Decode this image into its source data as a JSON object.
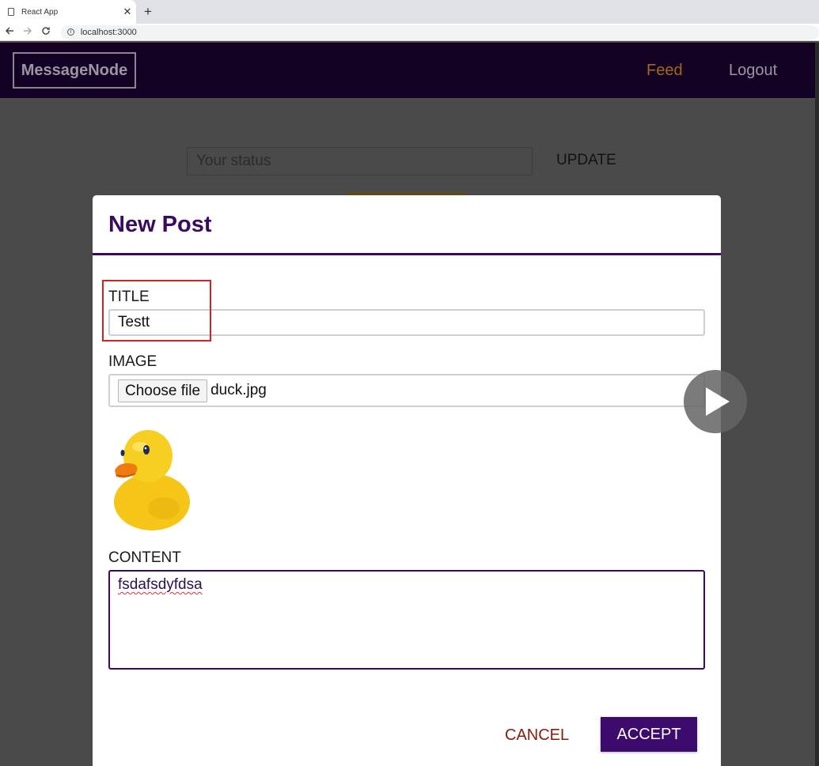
{
  "browser": {
    "tab_title": "React App",
    "tab_close": "✕",
    "new_tab": "+",
    "url": "localhost:3000",
    "info_glyph": "i"
  },
  "header": {
    "logo": "MessageNode",
    "nav": [
      {
        "label": "Feed"
      },
      {
        "label": "Logout"
      }
    ]
  },
  "status": {
    "placeholder": "Your status",
    "update_label": "UPDATE"
  },
  "modal": {
    "title": "New Post",
    "title_label": "TITLE",
    "title_value": "Testt",
    "image_label": "IMAGE",
    "choose_file_label": "Choose file",
    "file_name": "duck.jpg",
    "content_label": "CONTENT",
    "content_value": "fsdafsdyfdsa",
    "cancel_label": "CANCEL",
    "accept_label": "ACCEPT"
  },
  "colors": {
    "header_bg": "#130224",
    "accent_purple": "#3d0a6e",
    "feed_active": "#a06a1a",
    "cancel_red": "#8b1a0a",
    "highlight_red": "#d42020"
  },
  "icons": [
    "page-icon",
    "close-icon",
    "plus-icon",
    "back-arrow-icon",
    "forward-arrow-icon",
    "reload-icon",
    "info-icon",
    "duck-image",
    "play-icon"
  ]
}
